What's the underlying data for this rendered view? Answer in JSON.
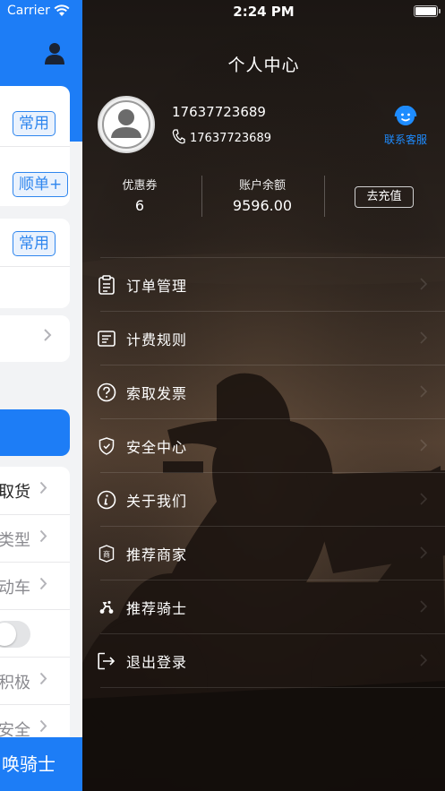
{
  "background_app": {
    "carrier": "Carrier",
    "tags": [
      "常用",
      "顺单+",
      "常用"
    ],
    "options": [
      {
        "label": "取货",
        "dark": true
      },
      {
        "label": "类型",
        "dark": false
      },
      {
        "label": "动车",
        "dark": false
      },
      {
        "label": "积极",
        "dark": false
      },
      {
        "label": "安全",
        "dark": false
      }
    ],
    "bottom_button": "唤骑士"
  },
  "status_bar": {
    "time": "2:24 PM"
  },
  "drawer": {
    "title": "个人中心",
    "user": {
      "name": "17637723689",
      "phone": "17637723689"
    },
    "customer_service": {
      "label": "联系客服",
      "icon": "customer-service-icon"
    },
    "stats": {
      "coupon_label": "优惠券",
      "coupon_value": "6",
      "balance_label": "账户余额",
      "balance_value": "9596.00",
      "recharge_label": "去充值"
    },
    "menu": [
      {
        "label": "订单管理",
        "icon": "clipboard-icon"
      },
      {
        "label": "计费规则",
        "icon": "rules-card-icon"
      },
      {
        "label": "索取发票",
        "icon": "question-icon"
      },
      {
        "label": "安全中心",
        "icon": "shield-icon"
      },
      {
        "label": "关于我们",
        "icon": "info-icon"
      },
      {
        "label": "推荐商家",
        "icon": "merchant-icon"
      },
      {
        "label": "推荐骑士",
        "icon": "rider-icon"
      },
      {
        "label": "退出登录",
        "icon": "logout-icon"
      }
    ]
  },
  "colors": {
    "accent": "#1d7df6",
    "customer_service": "#1e8cff"
  }
}
